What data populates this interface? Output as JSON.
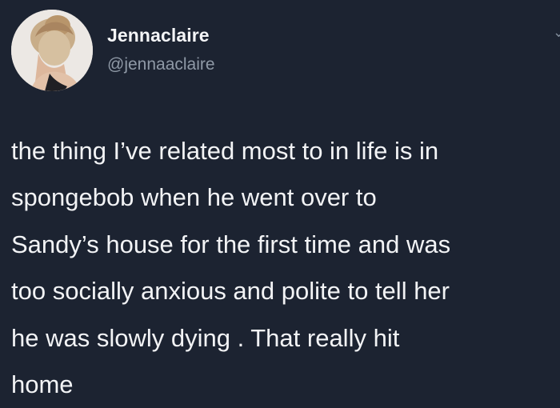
{
  "tweet": {
    "author": {
      "display_name": "Jennaclaire",
      "handle": "@jennaaclaire",
      "avatar_icon": "profile-photo"
    },
    "text": "the thing I’ve related most to in life is in\nspongebob when he went over to\nSandy’s house for the first time and was\ntoo socially anxious and polite to tell her\nhe was slowly dying .  That really hit\nhome",
    "more_icon": "chevron-down-icon"
  },
  "colors": {
    "background": "#1c2331",
    "primary_text": "#f2f3f5",
    "secondary_text": "#8f99a6"
  }
}
